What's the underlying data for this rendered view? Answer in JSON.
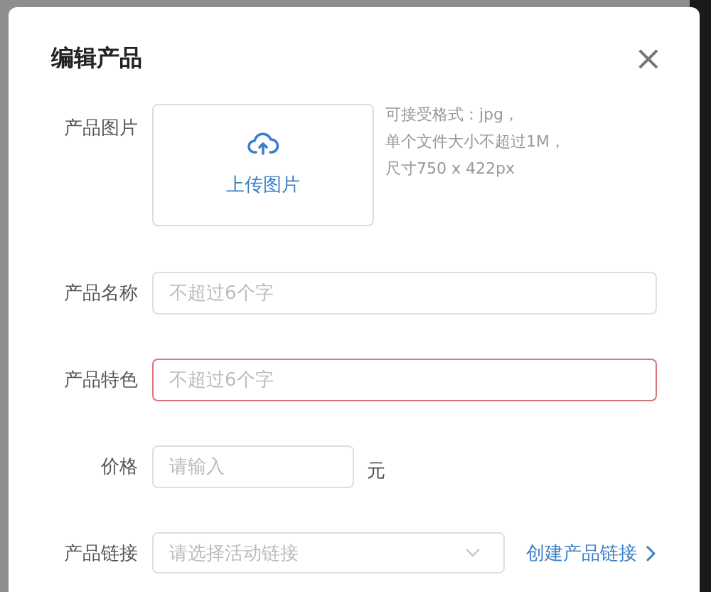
{
  "dialog": {
    "title": "编辑产品",
    "close": "×"
  },
  "fields": [
    {
      "kind": "upload",
      "label": "产品图片",
      "button": "上传图片",
      "hints": [
        "可接受格式：jpg，",
        "单个文件大小不超过1M，",
        "尺寸750 x 422px"
      ]
    },
    {
      "kind": "text",
      "label": "产品名称",
      "placeholder": "不超过6个字",
      "error": false
    },
    {
      "kind": "text",
      "label": "产品特色",
      "placeholder": "不超过6个字",
      "error": true
    },
    {
      "kind": "price",
      "label": "价格",
      "placeholder": "请输入",
      "unit": "元",
      "error": false
    },
    {
      "kind": "select",
      "label": "产品链接",
      "placeholder": "请选择活动链接",
      "link": "创建产品链接"
    }
  ]
}
